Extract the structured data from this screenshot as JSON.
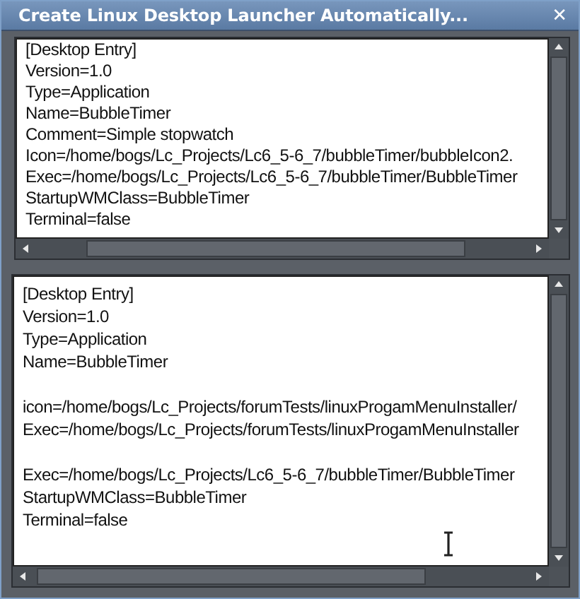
{
  "window": {
    "title": "Create Linux Desktop Launcher Automatically...",
    "close": "✕"
  },
  "panes": [
    {
      "paragraphs": [
        [
          "[Desktop Entry]",
          "Version=1.0",
          "Type=Application",
          "Name=BubbleTimer",
          "Comment=Simple stopwatch",
          "Icon=/home/bogs/Lc_Projects/Lc6_5-6_7/bubbleTimer/bubbleIcon2.",
          "Exec=/home/bogs/Lc_Projects/Lc6_5-6_7/bubbleTimer/BubbleTimer",
          "StartupWMClass=BubbleTimer",
          "Terminal=false"
        ]
      ],
      "text_cursor": false
    },
    {
      "paragraphs": [
        [
          "[Desktop Entry]",
          "Version=1.0",
          "Type=Application",
          "Name=BubbleTimer"
        ],
        [
          "icon=/home/bogs/Lc_Projects/forumTests/linuxProgamMenuInstaller/",
          "Exec=/home/bogs/Lc_Projects/forumTests/linuxProgamMenuInstaller"
        ],
        [
          "Exec=/home/bogs/Lc_Projects/Lc6_5-6_7/bubbleTimer/BubbleTimer",
          "StartupWMClass=BubbleTimer",
          "Terminal=false"
        ]
      ],
      "text_cursor": true
    }
  ]
}
